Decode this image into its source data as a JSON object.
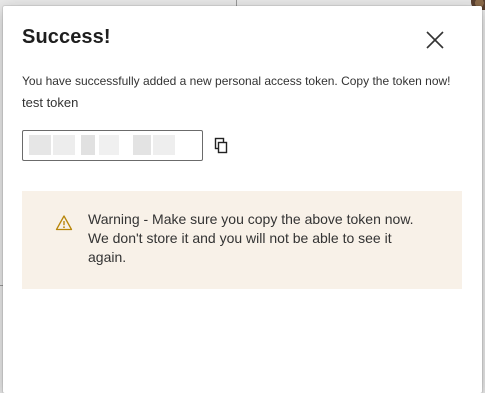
{
  "dialog": {
    "title": "Success!",
    "message": "You have successfully added a new personal access token. Copy the token now!",
    "token_name": "test token",
    "token_value": "",
    "close_icon": "close-icon",
    "copy_icon": "copy-icon"
  },
  "warning": {
    "icon": "warning-icon",
    "text": "Warning - Make sure you copy the above token now. We don't store it and you will not be able to see it again."
  },
  "colors": {
    "warning_background": "#f8f1e8",
    "warning_icon": "#b8860b",
    "title_text": "#1e1e1e"
  }
}
